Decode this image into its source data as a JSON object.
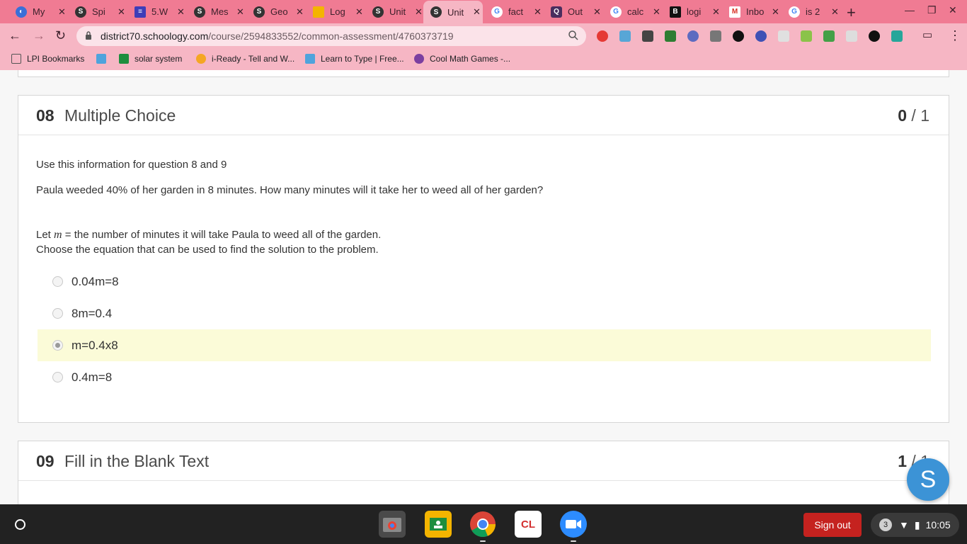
{
  "browser": {
    "tabs": [
      {
        "title": "My",
        "icon": "chrome-blue-icon",
        "color": "#3b6fd8"
      },
      {
        "title": "Spi",
        "icon": "schoology-icon",
        "color": "#333333"
      },
      {
        "title": "5.W",
        "icon": "list-icon",
        "color": "#3d3db8"
      },
      {
        "title": "Mes",
        "icon": "schoology-icon",
        "color": "#333333"
      },
      {
        "title": "Geo",
        "icon": "schoology-icon",
        "color": "#333333"
      },
      {
        "title": "Log",
        "icon": "slides-icon",
        "color": "#f4b400"
      },
      {
        "title": "Unit",
        "icon": "schoology-icon",
        "color": "#333333"
      },
      {
        "title": "Unit",
        "icon": "schoology-icon",
        "color": "#333333",
        "active": true
      },
      {
        "title": "fact",
        "icon": "google-icon",
        "color": "#ffffff"
      },
      {
        "title": "Out",
        "icon": "quizlet-icon",
        "color": "#4a2d5e"
      },
      {
        "title": "calc",
        "icon": "google-icon",
        "color": "#ffffff"
      },
      {
        "title": "logi",
        "icon": "bold-b-icon",
        "color": "#111111"
      },
      {
        "title": "Inbo",
        "icon": "gmail-icon",
        "color": "#ffffff"
      },
      {
        "title": "is 2",
        "icon": "google-icon",
        "color": "#ffffff"
      }
    ],
    "url_host": "district70.schoology.com",
    "url_path": "/course/2594833552/common-assessment/4760373719",
    "bookmarks": [
      {
        "label": "LPI Bookmarks",
        "icon": "folder-icon"
      },
      {
        "label": "",
        "icon": "t-icon"
      },
      {
        "label": "solar system",
        "icon": "classroom-icon"
      },
      {
        "label": "i-Ready - Tell and W...",
        "icon": "iready-icon"
      },
      {
        "label": "",
        "icon": "t-icon"
      },
      {
        "label": "Learn to Type | Free...",
        "icon": "t-icon"
      },
      {
        "label": "Cool Math Games -...",
        "icon": "coolmath-icon"
      }
    ]
  },
  "question8": {
    "number": "08",
    "type": "Multiple Choice",
    "score_earned": "0",
    "score_sep": " / ",
    "score_total": "1",
    "intro": "Use this information for question 8 and 9",
    "problem": "Paula weeded 40% of her garden in 8 minutes. How many minutes will it take her to weed all of her garden?",
    "let_prefix": "Let ",
    "variable": "m",
    "let_suffix": " = the number of minutes it will take Paula to weed all of the garden.",
    "instruction": "Choose the equation that can be used to find the solution to the problem.",
    "choices": [
      "0.04m=8",
      "8m=0.4",
      "m=0.4x8",
      "0.4m=8"
    ],
    "selected_index": 2
  },
  "question9": {
    "number": "09",
    "type": "Fill in the Blank Text",
    "score_earned": "1",
    "score_sep": " / ",
    "score_total": "1"
  },
  "fab_letter": "S",
  "shelf": {
    "signout_label": "Sign out",
    "notification_count": "3",
    "time": "10:05"
  }
}
